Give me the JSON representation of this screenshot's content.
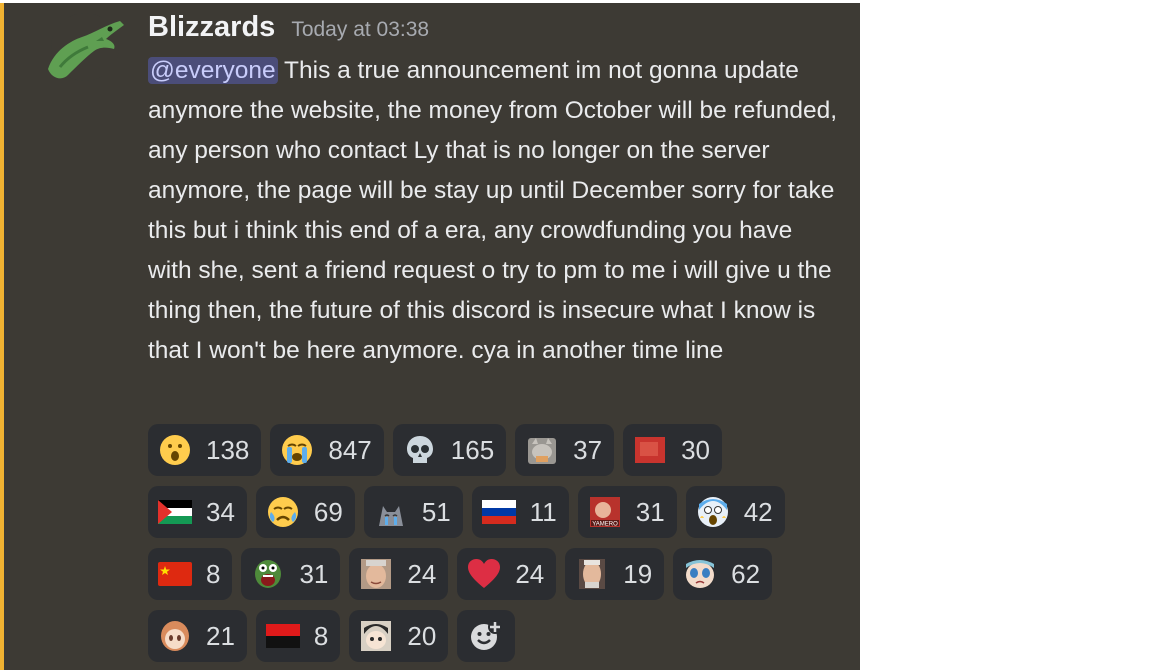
{
  "message": {
    "username": "Blizzards",
    "timestamp": "Today at 03:38",
    "mention": "@everyone",
    "text": " This a true announcement im not gonna update anymore the website, the money from October will be refunded, any person who contact Ly that is no longer on the server anymore, the page will be stay up until December sorry for take this but i think this end of a era, any crowdfunding you have with she, sent a friend request o try to pm to me i will give u the thing then, the future of this discord is insecure what I know is that I won't be here anymore. cya in another time line"
  },
  "colors": {
    "accent": "#f0b232",
    "background": "#3d3a34",
    "mention_bg": "#4b4d79",
    "reaction_bg": "#2b2d31"
  },
  "reactions": [
    {
      "icon": "surprised-face",
      "count": "138"
    },
    {
      "icon": "loudly-crying-face",
      "count": "847"
    },
    {
      "icon": "skull",
      "count": "165"
    },
    {
      "icon": "grey-cat-sticker",
      "count": "37"
    },
    {
      "icon": "red-blurry-image",
      "count": "30"
    },
    {
      "icon": "palestine-flag",
      "count": "34"
    },
    {
      "icon": "crying-face",
      "count": "69"
    },
    {
      "icon": "crying-cat",
      "count": "51"
    },
    {
      "icon": "russia-flag",
      "count": "11"
    },
    {
      "icon": "yamero-image",
      "count": "31"
    },
    {
      "icon": "screaming-face",
      "count": "42"
    },
    {
      "icon": "china-flag",
      "count": "8"
    },
    {
      "icon": "pepe-scream",
      "count": "31"
    },
    {
      "icon": "harold-face",
      "count": "24"
    },
    {
      "icon": "red-heart",
      "count": "24"
    },
    {
      "icon": "old-man-face",
      "count": "19"
    },
    {
      "icon": "anime-crying-face",
      "count": "62"
    },
    {
      "icon": "anime-girl-face",
      "count": "21"
    },
    {
      "icon": "red-black-flag",
      "count": "8"
    },
    {
      "icon": "anime-character-face",
      "count": "20"
    }
  ],
  "add_reaction_icon": "add-reaction-icon"
}
